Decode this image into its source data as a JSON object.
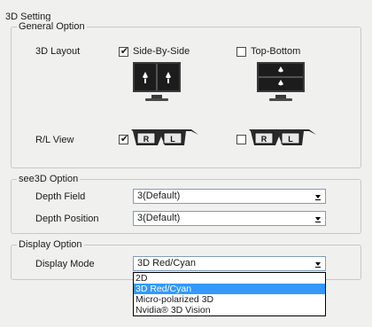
{
  "title": "3D Setting",
  "general": {
    "legend": "General Option",
    "layout_label": "3D Layout",
    "side_by_side": {
      "label": "Side-By-Side",
      "checked": true
    },
    "top_bottom": {
      "label": "Top-Bottom",
      "checked": false
    },
    "rl_label": "R/L View",
    "rl_view_1": {
      "checked": true,
      "lens_right": "R",
      "lens_left": "L"
    },
    "rl_view_2": {
      "checked": false,
      "lens_right": "R",
      "lens_left": "L"
    }
  },
  "see3d": {
    "legend": "see3D Option",
    "depth_field_label": "Depth Field",
    "depth_field_value": "3(Default)",
    "depth_position_label": "Depth Position",
    "depth_position_value": "3(Default)"
  },
  "display": {
    "legend": "Display Option",
    "mode_label": "Display Mode",
    "mode_value": "3D Red/Cyan",
    "options": [
      "2D",
      "3D Red/Cyan",
      "Micro-polarized 3D",
      "Nvidia® 3D Vision"
    ],
    "selected_index": 1
  },
  "colors": {
    "selection": "#3399ff",
    "panel": "#f0f0ee",
    "monitor": "#1c1c1c"
  }
}
